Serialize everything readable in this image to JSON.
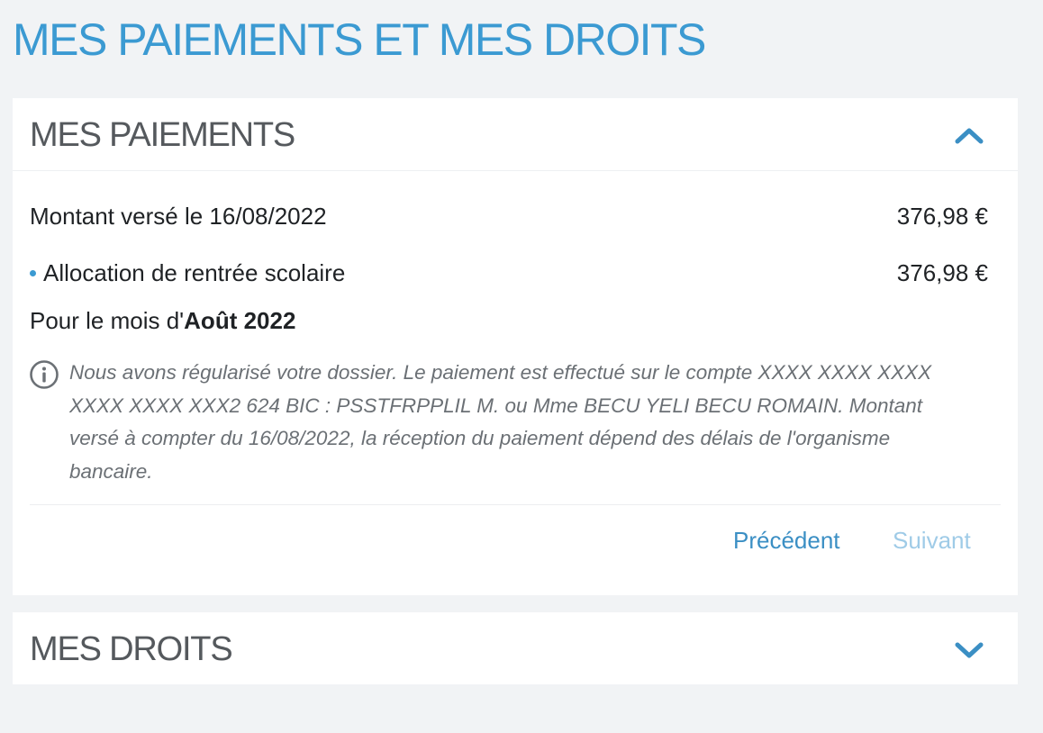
{
  "page": {
    "title": "MES PAIEMENTS ET MES DROITS"
  },
  "payments": {
    "title": "MES PAIEMENTS",
    "toggle_icon": "chevron-up-icon",
    "total": {
      "label": "Montant versé le 16/08/2022",
      "amount": "376,98 €"
    },
    "items": [
      {
        "label": "Allocation de rentrée scolaire",
        "amount": "376,98 €"
      }
    ],
    "month_prefix": "Pour le mois d'",
    "month_value": "Août 2022",
    "info_icon": "info-circle-icon",
    "info_text": "Nous avons régularisé votre dossier. Le paiement est effectué sur le compte XXXX XXXX XXXX XXXX XXXX XXX2 624 BIC : PSSTFRPPLIL M. ou Mme BECU YELI BECU ROMAIN. Montant versé à compter du 16/08/2022, la réception du paiement dépend des délais de l'organisme bancaire.",
    "pager": {
      "previous": "Précédent",
      "next": "Suivant"
    }
  },
  "rights": {
    "title": "MES DROITS",
    "toggle_icon": "chevron-down-icon"
  },
  "colors": {
    "accent": "#3b9ad2",
    "disabled_link": "#9fcbe7",
    "background": "#f1f3f5",
    "heading_gray": "#55595d"
  }
}
